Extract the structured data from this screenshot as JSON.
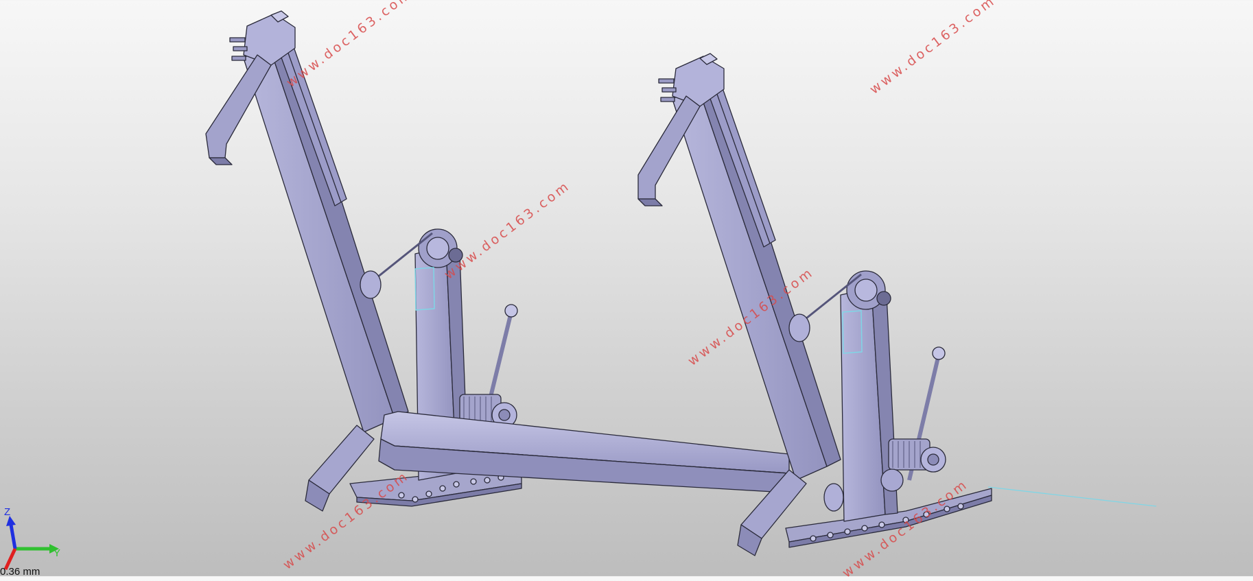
{
  "viewport": {
    "watermark_text": "www.doc163.com",
    "triad": {
      "z_label": "Z",
      "y_label": "Y"
    },
    "scale_readout": "0.36 mm"
  },
  "colors": {
    "part_fill": "#a9a9cf",
    "part_shade": "#8d8db8",
    "part_light": "#c3c3e2",
    "edge": "#2a2a3a",
    "watermark": "#d84a4a",
    "axis_x": "#e02020",
    "axis_y": "#30c030",
    "axis_z": "#2030e0",
    "highlight": "#7fd6e6"
  },
  "icons": [
    "coordinate-triad-icon"
  ]
}
